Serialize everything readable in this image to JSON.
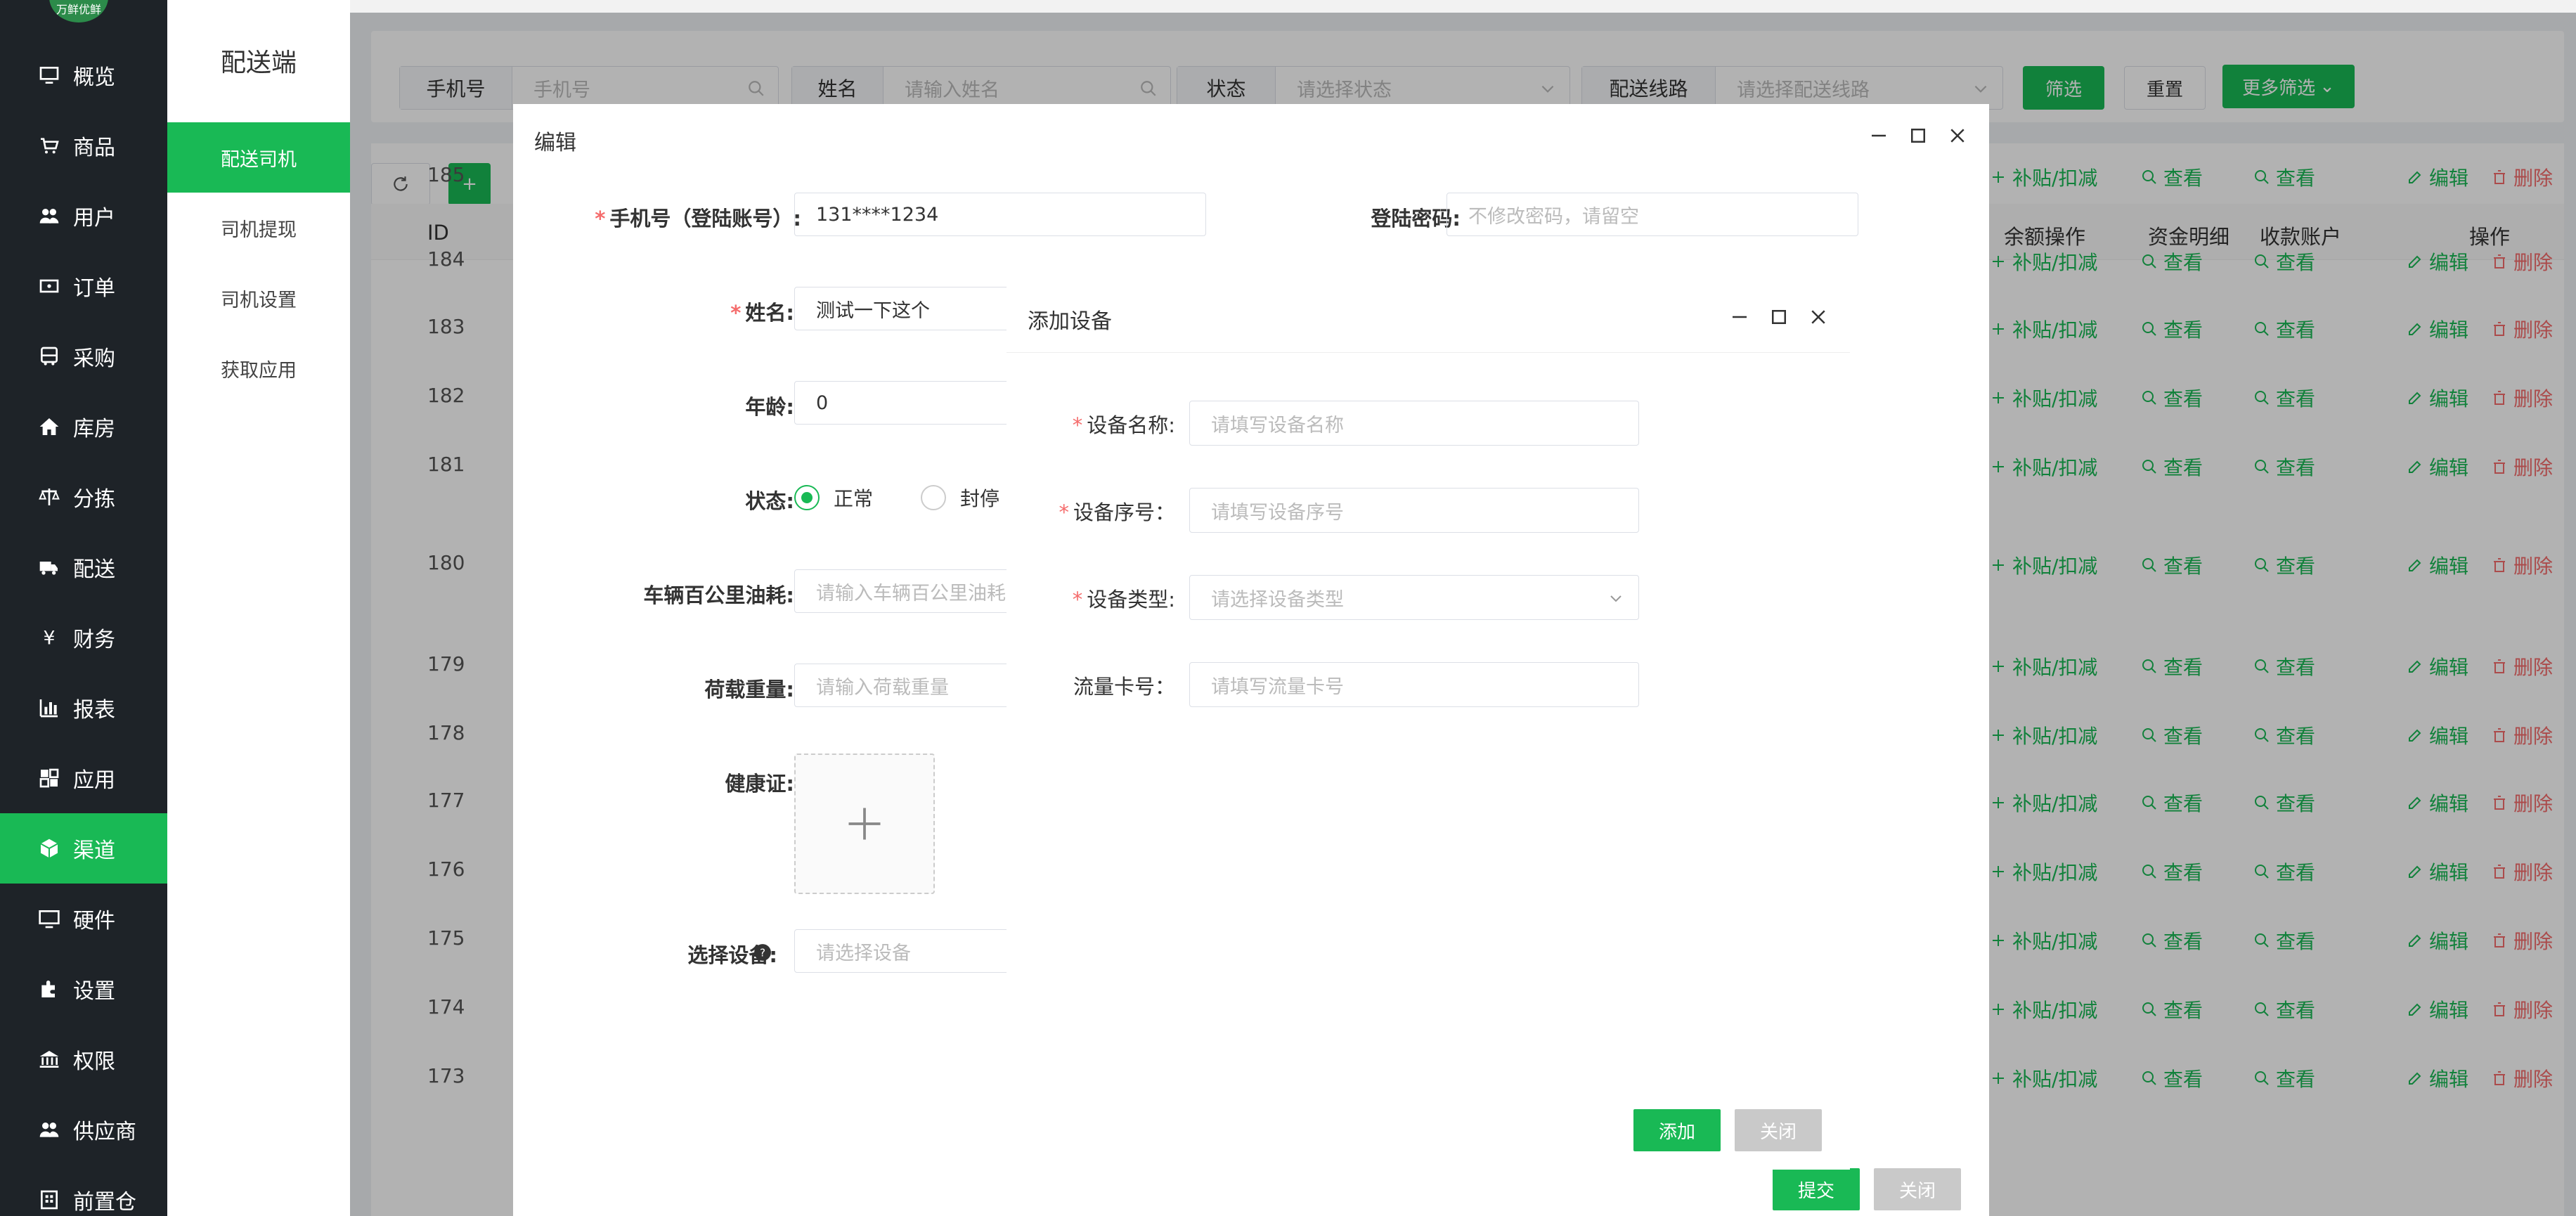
{
  "app": {
    "logo_text": "万鲜优鲜"
  },
  "nav": {
    "items": [
      {
        "label": "概览",
        "icon": "monitor-icon"
      },
      {
        "label": "商品",
        "icon": "cart-icon"
      },
      {
        "label": "用户",
        "icon": "users-icon"
      },
      {
        "label": "订单",
        "icon": "ticket-icon"
      },
      {
        "label": "采购",
        "icon": "bus-icon"
      },
      {
        "label": "库房",
        "icon": "home-icon"
      },
      {
        "label": "分拣",
        "icon": "scale-icon"
      },
      {
        "label": "配送",
        "icon": "truck-icon"
      },
      {
        "label": "财务",
        "icon": "yen-icon"
      },
      {
        "label": "报表",
        "icon": "bar-chart-icon"
      },
      {
        "label": "应用",
        "icon": "apps-icon"
      },
      {
        "label": "渠道",
        "icon": "cube-icon"
      },
      {
        "label": "硬件",
        "icon": "desktop-icon"
      },
      {
        "label": "设置",
        "icon": "puzzle-icon"
      },
      {
        "label": "权限",
        "icon": "bank-icon"
      },
      {
        "label": "供应商",
        "icon": "users-icon"
      },
      {
        "label": "前置仓",
        "icon": "building-icon"
      }
    ],
    "active": "渠道"
  },
  "subnav": {
    "title": "配送端",
    "items": [
      "配送司机",
      "司机提现",
      "司机设置",
      "获取应用"
    ],
    "active": "配送司机"
  },
  "filters": {
    "phone_label": "手机号",
    "phone_placeholder": "手机号",
    "name_label": "姓名",
    "name_placeholder": "请输入姓名",
    "status_label": "状态",
    "status_placeholder": "请选择状态",
    "route_label": "配送线路",
    "route_placeholder": "请选择配送线路",
    "filter_btn": "筛选",
    "reset_btn": "重置",
    "more_btn": "更多筛选"
  },
  "table": {
    "headers": {
      "id": "ID",
      "balance_op": "余额操作",
      "fund_detail": "资金明细",
      "account": "收款账户",
      "ops": "操作"
    },
    "rows": [
      {
        "id": "185",
        "balance": "补贴/扣减",
        "fund": "查看",
        "account": "查看",
        "edit": "编辑",
        "delete": "删除"
      },
      {
        "id": "184",
        "balance": "补贴/扣减",
        "fund": "查看",
        "account": "查看",
        "edit": "编辑",
        "delete": "删除"
      },
      {
        "id": "183",
        "balance": "补贴/扣减",
        "fund": "查看",
        "account": "查看",
        "edit": "编辑",
        "delete": "删除"
      },
      {
        "id": "182",
        "balance": "补贴/扣减",
        "fund": "查看",
        "account": "查看",
        "edit": "编辑",
        "delete": "删除"
      },
      {
        "id": "181",
        "balance": "补贴/扣减",
        "fund": "查看",
        "account": "查看",
        "edit": "编辑",
        "delete": "删除"
      },
      {
        "id": "180",
        "balance": "补贴/扣减",
        "fund": "查看",
        "account": "查看",
        "edit": "编辑",
        "delete": "删除"
      },
      {
        "id": "179",
        "balance": "补贴/扣减",
        "fund": "查看",
        "account": "查看",
        "edit": "编辑",
        "delete": "删除"
      },
      {
        "id": "178",
        "balance": "补贴/扣减",
        "fund": "查看",
        "account": "查看",
        "edit": "编辑",
        "delete": "删除"
      },
      {
        "id": "177",
        "balance": "补贴/扣减",
        "fund": "查看",
        "account": "查看",
        "edit": "编辑",
        "delete": "删除"
      },
      {
        "id": "176",
        "balance": "补贴/扣减",
        "fund": "查看",
        "account": "查看",
        "edit": "编辑",
        "delete": "删除"
      },
      {
        "id": "175",
        "balance": "补贴/扣减",
        "fund": "查看",
        "account": "查看",
        "edit": "编辑",
        "delete": "删除"
      },
      {
        "id": "174",
        "balance": "补贴/扣减",
        "fund": "查看",
        "account": "查看",
        "edit": "编辑",
        "delete": "删除"
      },
      {
        "id": "173",
        "balance": "补贴/扣减",
        "fund": "查看",
        "account": "查看",
        "edit": "编辑",
        "delete": "删除"
      }
    ]
  },
  "edit_dialog": {
    "title": "编辑",
    "phone_label": "手机号（登陆账号）:",
    "phone_value": "131****1234",
    "password_label": "登陆密码:",
    "password_placeholder": "不修改密码，请留空",
    "name_label": "姓名:",
    "name_value": "测试一下这个",
    "age_label": "年龄:",
    "age_value": "0",
    "status_label": "状态:",
    "status_normal": "正常",
    "status_block": "封停",
    "fuel_label": "车辆百公里油耗:",
    "fuel_placeholder": "请输入车辆百公里油耗",
    "load_label": "荷载重量:",
    "load_placeholder": "请输入荷载重量",
    "health_label": "健康证:",
    "device_label": "选择设备:",
    "device_placeholder": "请选择设备",
    "submit_btn": "提交",
    "close_btn": "关闭"
  },
  "add_device_dialog": {
    "title": "添加设备",
    "name_label": "设备名称:",
    "name_placeholder": "请填写设备名称",
    "serial_label": "设备序号：",
    "serial_placeholder": "请填写设备序号",
    "type_label": "设备类型:",
    "type_placeholder": "请选择设备类型",
    "sim_label": "流量卡号：",
    "sim_placeholder": "请填写流量卡号",
    "add_btn": "添加",
    "close_btn": "关闭"
  },
  "colors": {
    "accent": "#19b955",
    "danger": "#f56c6c",
    "nav_bg": "#1e2328"
  }
}
